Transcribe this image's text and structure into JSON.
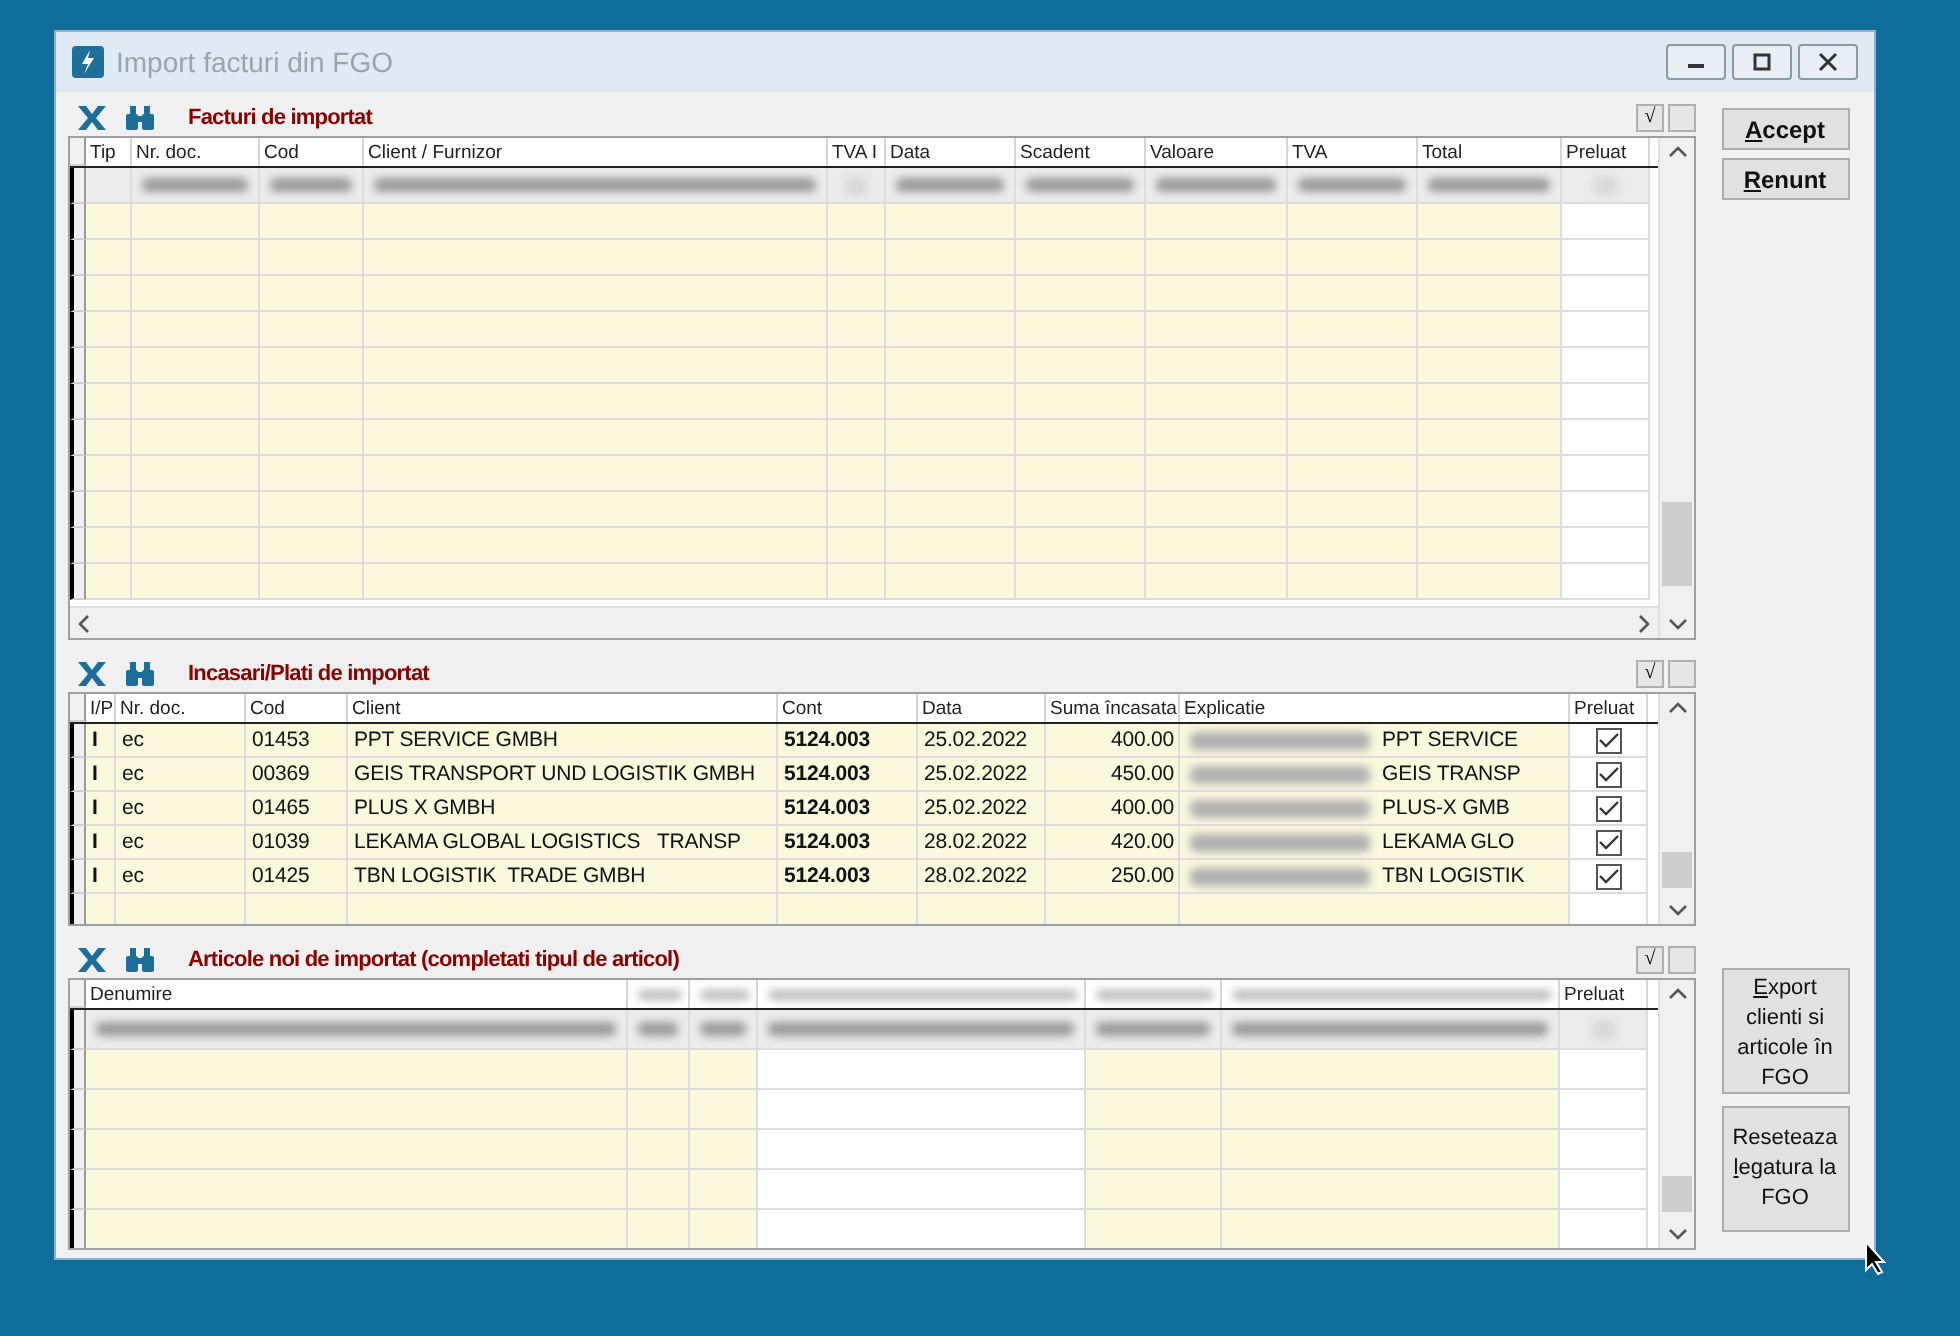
{
  "window": {
    "title": "Import facturi din FGO"
  },
  "sections": [
    {
      "title": "Facturi de importat",
      "toggle_label": "√",
      "columns": [
        {
          "label": "Tip"
        },
        {
          "label": "Nr. doc."
        },
        {
          "label": "Cod"
        },
        {
          "label": "Client / Furnizor"
        },
        {
          "label": "TVA I",
          "kind": "check"
        },
        {
          "label": "Data"
        },
        {
          "label": "Scadent"
        },
        {
          "label": "Valoare"
        },
        {
          "label": "TVA"
        },
        {
          "label": "Total"
        },
        {
          "label": "Preluat",
          "kind": "check"
        }
      ],
      "rows": [
        {
          "blurred": true
        }
      ]
    },
    {
      "title": "Incasari/Plati de importat",
      "toggle_label": "√",
      "columns": [
        {
          "label": "I/P",
          "kind": "bold"
        },
        {
          "label": "Nr. doc.",
          "kind": "text"
        },
        {
          "label": "Cod",
          "kind": "text"
        },
        {
          "label": "Client",
          "kind": "text"
        },
        {
          "label": "Cont",
          "kind": "bold"
        },
        {
          "label": "Data",
          "kind": "text"
        },
        {
          "label": "Suma încasata",
          "kind": "number"
        },
        {
          "label": "Explicatie",
          "kind": "note"
        },
        {
          "label": "Preluat",
          "kind": "check"
        }
      ],
      "rows": [
        {
          "cells": [
            "I",
            "ec",
            "01453",
            "PPT SERVICE GMBH",
            "5124.003",
            "25.02.2022",
            "400.00",
            "PPT SERVICE"
          ],
          "preluat": true
        },
        {
          "cells": [
            "I",
            "ec",
            "00369",
            "GEIS TRANSPORT UND LOGISTIK GMBH",
            "5124.003",
            "25.02.2022",
            "450.00",
            "GEIS TRANSP"
          ],
          "preluat": true
        },
        {
          "cells": [
            "I",
            "ec",
            "01465",
            "PLUS X GMBH",
            "5124.003",
            "25.02.2022",
            "400.00",
            "PLUS-X GMB"
          ],
          "preluat": true
        },
        {
          "cells": [
            "I",
            "ec",
            "01039",
            "LEKAMA GLOBAL LOGISTICS   TRANSP",
            "5124.003",
            "28.02.2022",
            "420.00",
            "LEKAMA GLO"
          ],
          "preluat": true
        },
        {
          "cells": [
            "I",
            "ec",
            "01425",
            "TBN LOGISTIK  TRADE GMBH",
            "5124.003",
            "28.02.2022",
            "250.00",
            "TBN LOGISTIK"
          ],
          "preluat": true
        }
      ]
    },
    {
      "title": "Articole noi de importat (completati tipul de articol)",
      "toggle_label": "√",
      "columns": [
        {
          "label": "Denumire"
        },
        {
          "blurred": true
        },
        {
          "blurred": true
        },
        {
          "blurred": true
        },
        {
          "blurred": true
        },
        {
          "blurred": true
        },
        {
          "label": "Preluat",
          "kind": "check"
        }
      ],
      "rows": [
        {
          "blurred": true
        }
      ]
    }
  ],
  "actions": [
    {
      "key": "A",
      "after": "ccept"
    },
    {
      "key": "R",
      "after": "enunt"
    }
  ],
  "tools": [
    {
      "key": "E",
      "after": "xport clienti si articole în FGO"
    },
    {
      "before": "Reseteaza ",
      "key": "l",
      "after": "egatura la FGO"
    }
  ]
}
